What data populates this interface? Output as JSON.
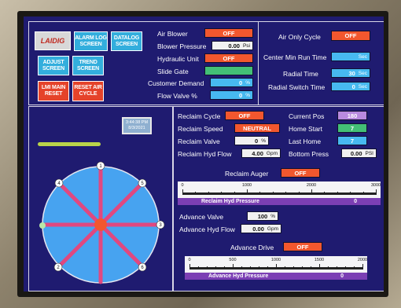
{
  "nav": {
    "logo": "LAIDIG",
    "alarm_log": "ALARM LOG SCREEN",
    "datalog": "DATALOG SCREEN",
    "adjust": "ADJUST SCREEN",
    "trend": "TREND SCREEN",
    "lmi_reset": "LMI MAIN RESET",
    "reset_air": "RESET AIR CYCLE"
  },
  "top_mid": {
    "air_blower_label": "Air Blower",
    "air_blower_value": "OFF",
    "blower_pressure_label": "Blower Pressure",
    "blower_pressure_value": "0.00",
    "blower_pressure_unit": "Psi",
    "hydraulic_unit_label": "Hydraulic Unit",
    "hydraulic_unit_value": "OFF",
    "slide_gate_label": "Slide Gate",
    "customer_demand_label": "Customer Demand",
    "customer_demand_value": "0",
    "customer_demand_unit": "%",
    "flow_valve_label": "Flow Valve %",
    "flow_valve_value": "0",
    "flow_valve_unit": "%"
  },
  "top_right": {
    "air_only_cycle_label": "Air Only Cycle",
    "air_only_cycle_value": "OFF",
    "center_min_run_label": "Center Min Run Time",
    "center_min_run_unit": "Sec",
    "radial_time_label": "Radial Time",
    "radial_time_value": "30",
    "radial_time_unit": "Sec",
    "radial_switch_label": "Radial Switch Time",
    "radial_switch_value": "0",
    "radial_switch_unit": "Sec"
  },
  "silo": {
    "datetime_line1": "3:44:38 PM",
    "datetime_line2": "8/3/2021",
    "rake_positions": [
      "1",
      "2",
      "3",
      "4",
      "5",
      "6"
    ]
  },
  "reclaim": {
    "cycle_label": "Reclaim Cycle",
    "cycle_value": "OFF",
    "speed_label": "Reclaim Speed",
    "speed_value": "NEUTRAL",
    "valve_label": "Reclaim Valve",
    "valve_value": "0",
    "valve_unit": "%",
    "hyd_flow_label": "Reclaim Hyd Flow",
    "hyd_flow_value": "4.00",
    "hyd_flow_unit": "Gpm",
    "current_pos_label": "Current Pos",
    "current_pos_value": "180",
    "home_start_label": "Home Start",
    "home_start_value": "7",
    "last_home_label": "Last Home",
    "last_home_value": "7",
    "bottom_press_label": "Bottom Press",
    "bottom_press_value": "0.00",
    "bottom_press_unit": "PSI",
    "auger_label": "Reclaim Auger",
    "auger_value": "OFF"
  },
  "reclaim_gauge": {
    "title": "Reclaim Hyd Pressure",
    "value": "0",
    "ticks": [
      "0",
      "1000",
      "2000",
      "3000"
    ],
    "level": 0
  },
  "advance": {
    "valve_label": "Advance Valve",
    "valve_value": "100",
    "valve_unit": "%",
    "hyd_flow_label": "Advance Hyd Flow",
    "hyd_flow_value": "0.00",
    "hyd_flow_unit": "Gpm",
    "drive_label": "Advance Drive",
    "drive_value": "OFF"
  },
  "advance_gauge": {
    "title": "Advance Hyd Pressure",
    "value": "0",
    "ticks": [
      "0",
      "500",
      "1000",
      "1500",
      "2000"
    ],
    "level": 0
  },
  "colors": {
    "screen_bg": "#1f1b70",
    "alarm_red": "#f2572e",
    "cyan": "#47b9f0"
  }
}
